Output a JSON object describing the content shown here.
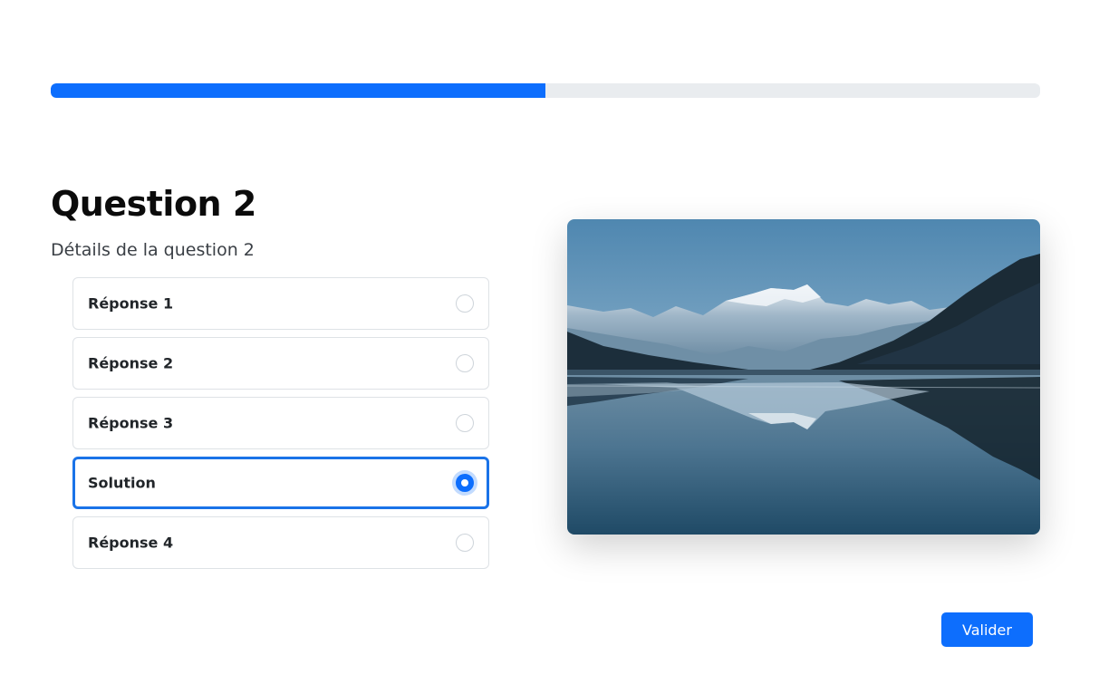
{
  "progress": {
    "percent": 50
  },
  "question": {
    "title": "Question 2",
    "details": "Détails de la question 2"
  },
  "answers": [
    {
      "label": "Réponse 1",
      "selected": false
    },
    {
      "label": "Réponse 2",
      "selected": false
    },
    {
      "label": "Réponse 3",
      "selected": false
    },
    {
      "label": "Solution",
      "selected": true
    },
    {
      "label": "Réponse 4",
      "selected": false
    }
  ],
  "image": {
    "subject": "mountain-lake-landscape"
  },
  "actions": {
    "submit_label": "Valider"
  },
  "colors": {
    "accent": "#0d6efd",
    "progress_track": "#e9ecef",
    "border": "#dee2e6",
    "selected_border": "#1a73e8"
  }
}
